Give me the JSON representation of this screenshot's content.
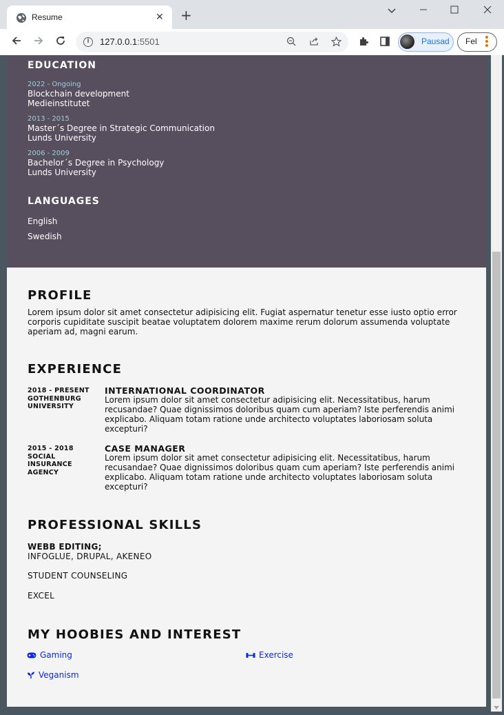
{
  "browser": {
    "tab_title": "Resume",
    "tab_close": "✕",
    "new_tab": "+",
    "window_controls": {
      "minimize": "⌄",
      "maximize": "—",
      "restore": "☐",
      "close": "✕"
    },
    "url_host": "127.0.0.1",
    "url_port": ":5501",
    "profile_label": "Pausad",
    "error_label": "Fel"
  },
  "education": {
    "heading": "EDUCATION",
    "items": [
      {
        "years": "2022 - Ongoing",
        "program": "Blockchain development",
        "school": "Medieinstitutet"
      },
      {
        "years": "2013 - 2015",
        "program": "Master´s Degree in Strategic Communication",
        "school": "Lunds University"
      },
      {
        "years": "2006 - 2009",
        "program": "Bachelor´s Degree in Psychology",
        "school": "Lunds University"
      }
    ]
  },
  "languages": {
    "heading": "LANGUAGES",
    "items": [
      "English",
      "Swedish"
    ]
  },
  "profile": {
    "heading": "PROFILE",
    "text": "Lorem ipsum dolor sit amet consectetur adipisicing elit. Fugiat aspernatur tenetur esse iusto optio error corporis cupiditate suscipit beatae voluptatem dolorem maxime rerum dolorum assumenda voluptate aperiam ad, magni earum."
  },
  "experience": {
    "heading": "EXPERIENCE",
    "items": [
      {
        "period": "2018 - PRESENT",
        "org_lines": [
          "GOTHENBURG",
          "UNIVERSITY"
        ],
        "title": "INTERNATIONAL COORDINATOR",
        "description": "Lorem ipsum dolor sit amet consectetur adipisicing elit. Necessitatibus, harum recusandae? Quae dignissimos doloribus quam cum aperiam? Iste perferendis animi explicabo. Aliquam totam ratione unde architecto voluptates laboriosam soluta excepturi?"
      },
      {
        "period": "2015 - 2018",
        "org_lines": [
          "SOCIAL",
          "INSURANCE",
          "AGENCY"
        ],
        "title": "CASE MANAGER",
        "description": "Lorem ipsum dolor sit amet consectetur adipisicing elit. Necessitatibus, harum recusandae? Quae dignissimos doloribus quam cum aperiam? Iste perferendis animi explicabo. Aliquam totam ratione unde architecto voluptates laboriosam soluta excepturi?"
      }
    ]
  },
  "skills": {
    "heading": "PROFESSIONAL SKILLS",
    "webb_label": "WEBB EDITING;",
    "webb_tools": "INFOGLUE, DRUPAL, AKENEO",
    "items": [
      "STUDENT COUNSELING",
      "EXCEL"
    ]
  },
  "hobbies": {
    "heading": "MY HOOBIES AND INTEREST",
    "items": [
      {
        "label": "Gaming",
        "icon": "gamepad-icon"
      },
      {
        "label": "Exercise",
        "icon": "dumbbell-icon"
      },
      {
        "label": "Veganism",
        "icon": "seedling-icon"
      }
    ],
    "link_color": "#0b2ad8"
  },
  "colors": {
    "sidebar_bg": "#574f5d",
    "page_bg": "#f4f4f4",
    "years_accent": "#9ecfe0"
  }
}
